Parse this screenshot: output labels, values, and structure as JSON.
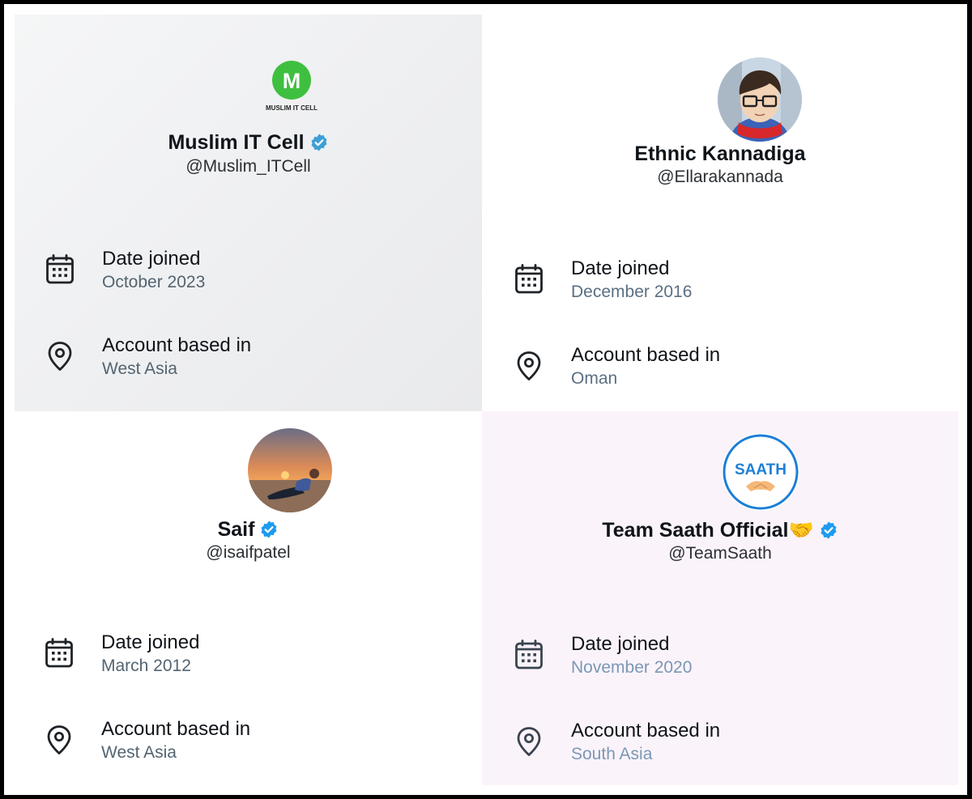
{
  "profiles": [
    {
      "name": "Muslim IT Cell",
      "handle": "@Muslim_ITCell",
      "verified": true,
      "avatar": {
        "letter": "M",
        "caption": "MUSLIM IT CELL",
        "color": "#3fbf3f"
      },
      "date_label": "Date joined",
      "date_value": "October 2023",
      "location_label": "Account based in",
      "location_value": "West Asia"
    },
    {
      "name": "Ethnic Kannadiga",
      "handle": "@Ellarakannada",
      "verified": false,
      "date_label": "Date joined",
      "date_value": "December 2016",
      "location_label": "Account based in",
      "location_value": "Oman"
    },
    {
      "name": "Saif",
      "handle": "@isaifpatel",
      "verified": true,
      "date_label": "Date joined",
      "date_value": "March 2012",
      "location_label": "Account based in",
      "location_value": "West Asia"
    },
    {
      "name": "Team Saath Official🤝",
      "handle": "@TeamSaath",
      "verified": true,
      "avatar": {
        "text": "SAATH",
        "color": "#1e7fd6"
      },
      "date_label": "Date joined",
      "date_value": "November 2020",
      "location_label": "Account based in",
      "location_value": "South Asia"
    }
  ],
  "icons": {
    "calendar": "calendar-icon",
    "location": "location-pin-icon",
    "verified": "verified-badge-icon"
  },
  "colors": {
    "verified_blue": "#1d9bf0",
    "text_primary": "#0f1419",
    "text_secondary": "#536471"
  }
}
